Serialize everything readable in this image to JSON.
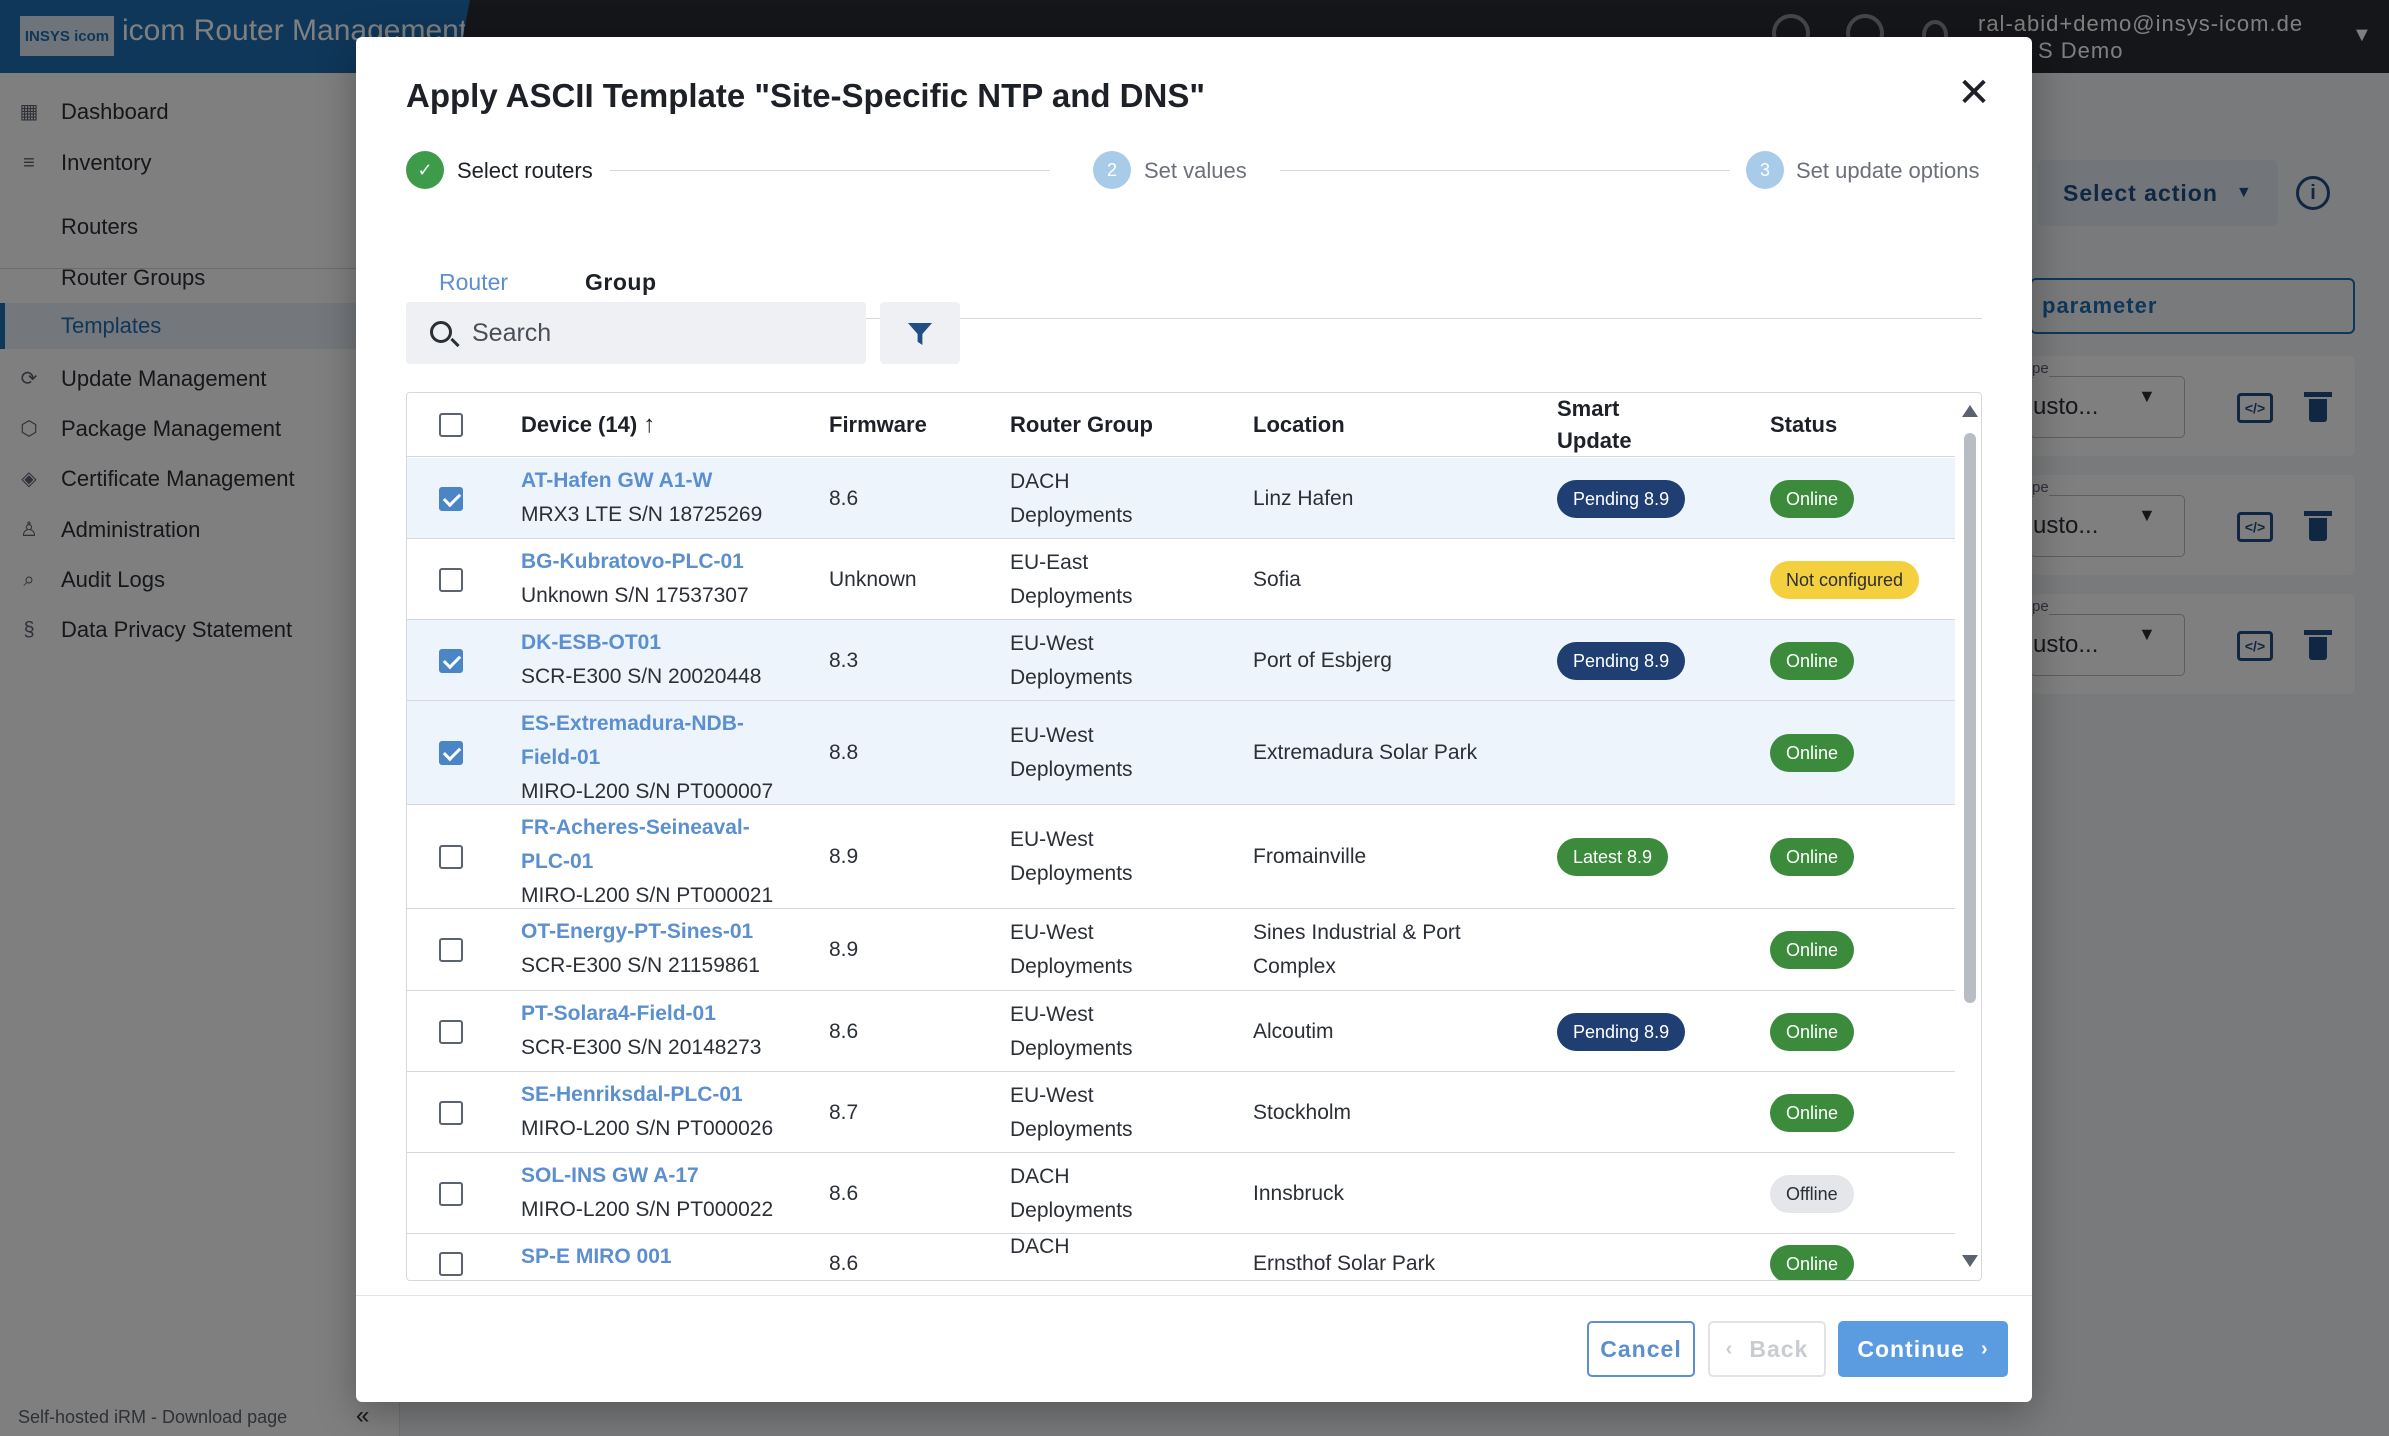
{
  "app": {
    "logo_text": "INSYS icom",
    "title": "icom Router Management",
    "user_email": "ral-abid+demo@insys-icom.de",
    "user_org": "S Demo"
  },
  "sidebar": {
    "items": [
      {
        "label": "Dashboard",
        "icon": "dashboard-icon"
      },
      {
        "label": "Inventory",
        "icon": "inventory-icon"
      },
      {
        "label": "Routers"
      },
      {
        "label": "Router Groups"
      },
      {
        "label": "Templates"
      },
      {
        "label": "Update Management",
        "icon": "update-icon"
      },
      {
        "label": "Package Management",
        "icon": "package-icon"
      },
      {
        "label": "Certificate Management",
        "icon": "certificate-icon"
      },
      {
        "label": "Administration",
        "icon": "admin-icon"
      },
      {
        "label": "Audit Logs",
        "icon": "audit-icon"
      },
      {
        "label": "Data Privacy Statement",
        "icon": "section-icon"
      }
    ],
    "footer": "Self-hosted iRM - Download page"
  },
  "background": {
    "select_action": "Select action",
    "parameter_button": "parameter",
    "type_label": "pe",
    "type_value": "usto..."
  },
  "modal": {
    "title": "Apply ASCII Template \"Site-Specific NTP and DNS\"",
    "steps": [
      {
        "number": "✓",
        "label": "Select routers",
        "state": "done"
      },
      {
        "number": "2",
        "label": "Set values",
        "state": "pending"
      },
      {
        "number": "3",
        "label": "Set update options",
        "state": "pending"
      }
    ],
    "tabs": [
      {
        "label": "Router",
        "active": true
      },
      {
        "label": "Group",
        "active": false
      }
    ],
    "search_placeholder": "Search",
    "table": {
      "columns": {
        "device": "Device (14)",
        "firmware": "Firmware",
        "router_group": "Router Group",
        "location": "Location",
        "smart_update": "Smart Update",
        "status": "Status"
      },
      "rows": [
        {
          "name": "AT-Hafen GW A1-W",
          "sub": "MRX3 LTE S/N 18725269",
          "firmware": "8.6",
          "group": "DACH Deployments",
          "location": "Linz Hafen",
          "smart_update": "Pending 8.9",
          "smart_kind": "pending",
          "status": "Online",
          "status_kind": "online",
          "checked": true
        },
        {
          "name": "BG-Kubratovo-PLC-01",
          "sub": "Unknown S/N 17537307",
          "firmware": "Unknown",
          "group": "EU-East Deployments",
          "location": "Sofia",
          "smart_update": "",
          "smart_kind": "",
          "status": "Not configured",
          "status_kind": "notconf",
          "checked": false
        },
        {
          "name": "DK-ESB-OT01",
          "sub": "SCR-E300 S/N 20020448",
          "firmware": "8.3",
          "group": "EU-West Deployments",
          "location": "Port of Esbjerg",
          "smart_update": "Pending 8.9",
          "smart_kind": "pending",
          "status": "Online",
          "status_kind": "online",
          "checked": true
        },
        {
          "name": "ES-Extremadura-NDB-Field-01",
          "sub": "MIRO-L200 S/N PT000007",
          "firmware": "8.8",
          "group": "EU-West Deployments",
          "location": "Extremadura Solar Park",
          "smart_update": "",
          "smart_kind": "",
          "status": "Online",
          "status_kind": "online",
          "checked": true
        },
        {
          "name": "FR-Acheres-Seineaval-PLC-01",
          "sub": "MIRO-L200 S/N PT000021",
          "firmware": "8.9",
          "group": "EU-West Deployments",
          "location": "Fromainville",
          "smart_update": "Latest 8.9",
          "smart_kind": "latest",
          "status": "Online",
          "status_kind": "online",
          "checked": false
        },
        {
          "name": "OT-Energy-PT-Sines-01",
          "sub": "SCR-E300 S/N 21159861",
          "firmware": "8.9",
          "group": "EU-West Deployments",
          "location": "Sines Industrial & Port Complex",
          "smart_update": "",
          "smart_kind": "",
          "status": "Online",
          "status_kind": "online",
          "checked": false
        },
        {
          "name": "PT-Solara4-Field-01",
          "sub": "SCR-E300 S/N 20148273",
          "firmware": "8.6",
          "group": "EU-West Deployments",
          "location": "Alcoutim",
          "smart_update": "Pending 8.9",
          "smart_kind": "pending",
          "status": "Online",
          "status_kind": "online",
          "checked": false
        },
        {
          "name": "SE-Henriksdal-PLC-01",
          "sub": "MIRO-L200 S/N PT000026",
          "firmware": "8.7",
          "group": "EU-West Deployments",
          "location": "Stockholm",
          "smart_update": "",
          "smart_kind": "",
          "status": "Online",
          "status_kind": "online",
          "checked": false
        },
        {
          "name": "SOL-INS GW A-17",
          "sub": "MIRO-L200 S/N PT000022",
          "firmware": "8.6",
          "group": "DACH Deployments",
          "location": "Innsbruck",
          "smart_update": "",
          "smart_kind": "",
          "status": "Offline",
          "status_kind": "offline",
          "checked": false
        },
        {
          "name": "SP-E MIRO 001",
          "sub": "",
          "firmware": "8.6",
          "group": "DACH",
          "location": "Ernsthof Solar Park",
          "smart_update": "",
          "smart_kind": "",
          "status": "Online",
          "status_kind": "online",
          "checked": false
        }
      ]
    },
    "buttons": {
      "cancel": "Cancel",
      "back": "Back",
      "continue": "Continue"
    }
  }
}
